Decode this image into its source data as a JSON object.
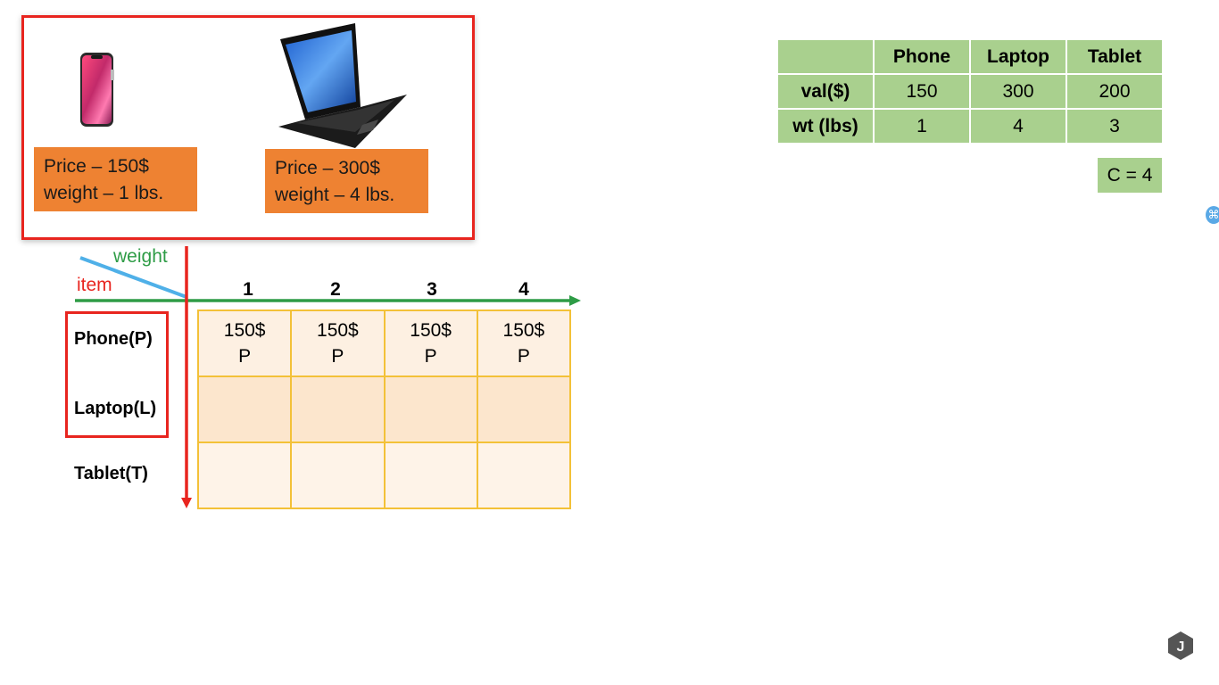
{
  "products": [
    {
      "id": "phone",
      "price_line": "Price – 150$",
      "weight_line": "weight – 1 lbs."
    },
    {
      "id": "laptop",
      "price_line": "Price – 300$",
      "weight_line": "weight – 4 lbs."
    }
  ],
  "axes": {
    "weight_label": "weight",
    "item_label": "item"
  },
  "columns": [
    "1",
    "2",
    "3",
    "4"
  ],
  "rows": [
    "Phone(P)",
    "Laptop(L)",
    "Tablet(T)"
  ],
  "grid": [
    [
      {
        "value": "150$",
        "item": "P"
      },
      {
        "value": "150$",
        "item": "P"
      },
      {
        "value": "150$",
        "item": "P"
      },
      {
        "value": "150$",
        "item": "P"
      }
    ],
    [
      {
        "value": "",
        "item": ""
      },
      {
        "value": "",
        "item": ""
      },
      {
        "value": "",
        "item": ""
      },
      {
        "value": "",
        "item": ""
      }
    ],
    [
      {
        "value": "",
        "item": ""
      },
      {
        "value": "",
        "item": ""
      },
      {
        "value": "",
        "item": ""
      },
      {
        "value": "",
        "item": ""
      }
    ]
  ],
  "reference_table": {
    "headers": [
      "",
      "Phone",
      "Laptop",
      "Tablet"
    ],
    "rows": [
      [
        "val($)",
        "150",
        "300",
        "200"
      ],
      [
        "wt (lbs)",
        "1",
        "4",
        "3"
      ]
    ]
  },
  "capacity": "C = 4",
  "badge": "J",
  "colors": {
    "panel_border": "#e8251f",
    "price_box": "#ee8232",
    "table_green": "#a9d08e",
    "weight_axis": "#2e9c46",
    "item_axis": "#e8251f",
    "grid_line": "#f3c138"
  }
}
